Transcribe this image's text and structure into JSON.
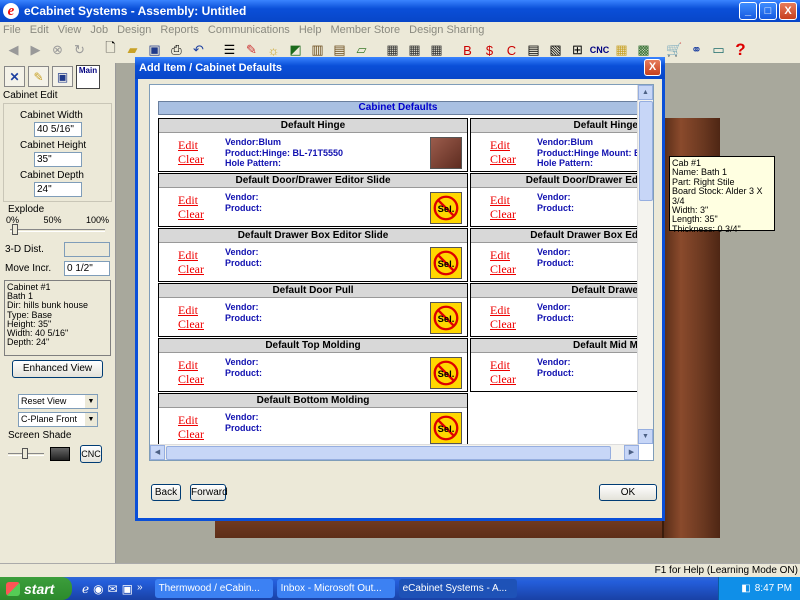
{
  "window": {
    "title": "eCabinet Systems - Assembly: Untitled",
    "logo_letter": "e",
    "minimize": "_",
    "maximize": "□",
    "close": "X"
  },
  "menu": [
    "File",
    "Edit",
    "View",
    "Job",
    "Design",
    "Reports",
    "Communications",
    "Help",
    "Member Store",
    "Design Sharing"
  ],
  "toolbar": {
    "cnc_label": "CNC",
    "help_glyph": "?"
  },
  "left_panel": {
    "main_tab_label": "Main",
    "cabinet_edit_title": "Cabinet Edit",
    "cabinet_width_label": "Cabinet Width",
    "cabinet_width_value": "40 5/16\"",
    "cabinet_height_label": "Cabinet Height",
    "cabinet_height_value": "35\"",
    "cabinet_depth_label": "Cabinet Depth",
    "cabinet_depth_value": "24\"",
    "explode_title": "Explode",
    "explode_scale": [
      "0%",
      "50%",
      "100%"
    ],
    "dist_label": "3-D Dist.",
    "dist_value": "",
    "move_incr_label": "Move Incr.",
    "move_incr_value": "0 1/2\"",
    "info_lines": [
      "Cabinet #1",
      "Bath 1",
      "Dir: hills bunk house",
      "Type: Base",
      "Height: 35\"",
      "Width: 40 5/16\"",
      "Depth: 24\""
    ],
    "enhanced_view_label": "Enhanced View",
    "reset_view_value": "Reset View",
    "cplane_value": "C-Plane Front",
    "screen_shade_title": "Screen Shade",
    "cnc_button_label": "CNC"
  },
  "tooltip": {
    "lines": [
      "Cab #1",
      "Name: Bath 1",
      "Part: Right Stile",
      "Board Stock: Alder  3 X 3/4",
      "Width: 3\"",
      "Length: 35\"",
      "Thickness: 0 3/4\""
    ]
  },
  "dialog": {
    "title": "Add Item / Cabinet Defaults",
    "close": "X",
    "table_title": "Cabinet Defaults",
    "edit_label": "Edit",
    "clear_label": "Clear",
    "sel_label": "Sel.",
    "vendor_label": "Vendor:",
    "product_label": "Product:",
    "back_label": "Back",
    "forward_label": "Forward",
    "ok_label": "OK",
    "hinge_vendor": "Vendor:Blum",
    "hinge_product_left": "Product:Hinge: BL-71T5550",
    "hinge_product_right": "Product:Hinge Mount: BL",
    "hinge_pattern": "Hole Pattern:",
    "left_column": [
      "Default Hinge",
      "Default Door/Drawer Editor Slide",
      "Default Drawer Box Editor Slide",
      "Default Door Pull",
      "Default Top Molding",
      "Default Bottom Molding"
    ],
    "right_column": [
      "Default Hinge",
      "Default Door/Drawer Ed",
      "Default Drawer Box Ed",
      "Default Drawe",
      "Default Mid M"
    ]
  },
  "status": {
    "help_text": "F1 for Help (Learning Mode ON)"
  },
  "taskbar": {
    "start_label": "start",
    "tasks": [
      "Thermwood / eCabin...",
      "Inbox - Microsoft Out...",
      "eCabinet Systems - A..."
    ],
    "clock": "8:47 PM"
  }
}
